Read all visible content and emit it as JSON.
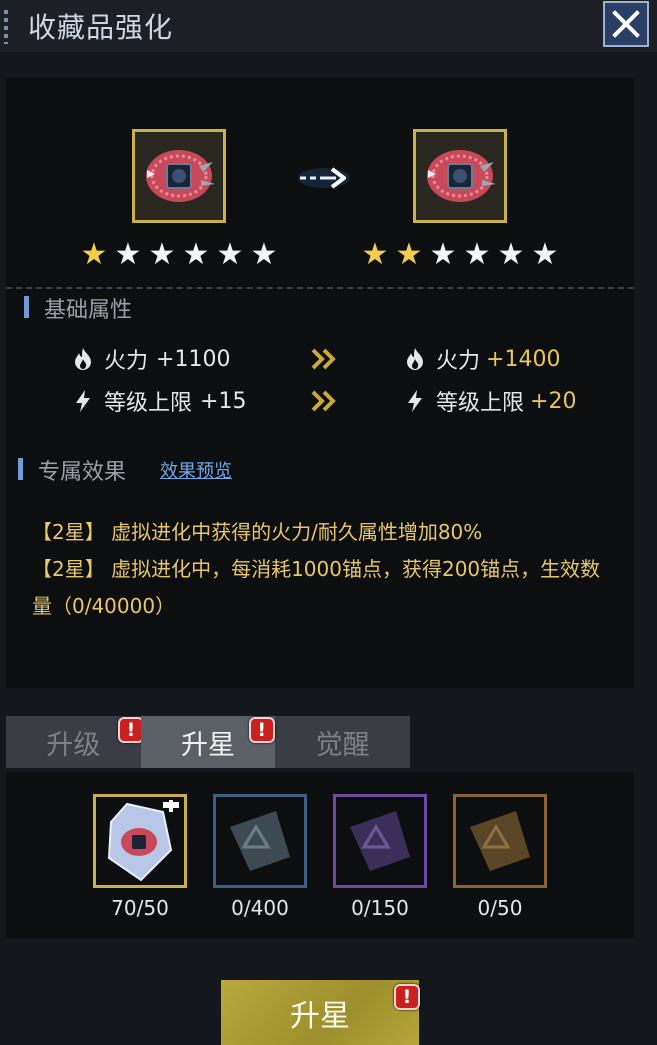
{
  "header": {
    "title": "收藏品强化",
    "close_icon": "close-icon"
  },
  "item": {
    "current_stars": 1,
    "next_stars": 2,
    "max_stars": 6,
    "star_char": "★"
  },
  "base_section": {
    "title": "基础属性",
    "rows": [
      {
        "icon": "fire-icon",
        "label": "火力",
        "current": "+1100",
        "next": "+1400"
      },
      {
        "icon": "lightning-icon",
        "label": "等级上限",
        "current": "+15",
        "next": "+20"
      }
    ]
  },
  "exclusive_section": {
    "title": "专属效果",
    "preview_link": "效果预览",
    "effect_lines": [
      "【2星】 虚拟进化中获得的火力/耐久属性增加80%",
      "【2星】 虚拟进化中，每消耗1000锚点，获得200锚点，生效数量（0/40000）"
    ]
  },
  "tabs": [
    {
      "label": "升级",
      "badge": "!"
    },
    {
      "label": "升星",
      "badge": "!",
      "active": true
    },
    {
      "label": "觉醒"
    }
  ],
  "materials": [
    {
      "count": "70/50",
      "border": "#c9b04a"
    },
    {
      "count": "0/400",
      "border": "#3f5f86"
    },
    {
      "count": "0/150",
      "border": "#6e4aa0"
    },
    {
      "count": "0/50",
      "border": "#8a6432"
    }
  ],
  "action_button": {
    "label": "升星",
    "badge": "!"
  }
}
